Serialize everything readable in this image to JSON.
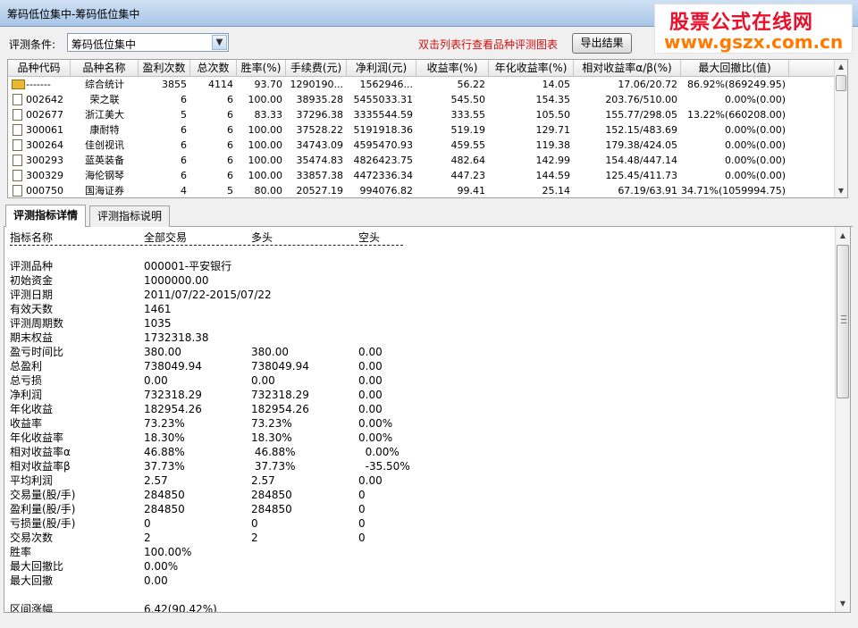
{
  "window": {
    "title": "筹码低位集中-筹码低位集中"
  },
  "watermark": {
    "line1": "股票公式在线网",
    "line2": "www.gszx.com.cn"
  },
  "toolbar": {
    "condition_label": "评测条件:",
    "condition_value": "筹码低位集中",
    "hint": "双击列表行查看品种评测图表",
    "export_label": "导出结果"
  },
  "grid": {
    "columns": [
      "品种代码",
      "品种名称",
      "盈利次数",
      "总次数",
      "胜率(%)",
      "手续费(元)",
      "净利润(元)",
      "收益率(%)",
      "年化收益率(%)",
      "相对收益率α/β(%)",
      "最大回撤比(值)"
    ],
    "rows": [
      {
        "icon": "folder",
        "code": "-------",
        "name": "综合统计",
        "wins": "3855",
        "total": "4114",
        "winrate": "93.70",
        "fee": "1290190...",
        "profit": "1562946...",
        "ret": "56.22",
        "annual": "14.05",
        "rel": "17.06/20.72",
        "dd": "86.92%(869249.95)"
      },
      {
        "icon": "file",
        "code": "002642",
        "name": "荣之联",
        "wins": "6",
        "total": "6",
        "winrate": "100.00",
        "fee": "38935.28",
        "profit": "5455033.31",
        "ret": "545.50",
        "annual": "154.35",
        "rel": "203.76/510.00",
        "dd": "0.00%(0.00)"
      },
      {
        "icon": "file",
        "code": "002677",
        "name": "浙江美大",
        "wins": "5",
        "total": "6",
        "winrate": "83.33",
        "fee": "37296.38",
        "profit": "3335544.59",
        "ret": "333.55",
        "annual": "105.50",
        "rel": "155.77/298.05",
        "dd": "13.22%(660208.00)"
      },
      {
        "icon": "file",
        "code": "300061",
        "name": "康耐特",
        "wins": "6",
        "total": "6",
        "winrate": "100.00",
        "fee": "37528.22",
        "profit": "5191918.36",
        "ret": "519.19",
        "annual": "129.71",
        "rel": "152.15/483.69",
        "dd": "0.00%(0.00)"
      },
      {
        "icon": "file",
        "code": "300264",
        "name": "佳创视讯",
        "wins": "6",
        "total": "6",
        "winrate": "100.00",
        "fee": "34743.09",
        "profit": "4595470.93",
        "ret": "459.55",
        "annual": "119.38",
        "rel": "179.38/424.05",
        "dd": "0.00%(0.00)"
      },
      {
        "icon": "file",
        "code": "300293",
        "name": "蓝英装备",
        "wins": "6",
        "total": "6",
        "winrate": "100.00",
        "fee": "35474.83",
        "profit": "4826423.75",
        "ret": "482.64",
        "annual": "142.99",
        "rel": "154.48/447.14",
        "dd": "0.00%(0.00)"
      },
      {
        "icon": "file",
        "code": "300329",
        "name": "海伦钢琴",
        "wins": "6",
        "total": "6",
        "winrate": "100.00",
        "fee": "33857.38",
        "profit": "4472336.34",
        "ret": "447.23",
        "annual": "144.59",
        "rel": "125.45/411.73",
        "dd": "0.00%(0.00)"
      },
      {
        "icon": "file",
        "code": "000750",
        "name": "国海证券",
        "wins": "4",
        "total": "5",
        "winrate": "80.00",
        "fee": "20527.19",
        "profit": "994076.82",
        "ret": "99.41",
        "annual": "25.14",
        "rel": "67.19/63.91",
        "dd": "34.71%(1059994.75)"
      }
    ]
  },
  "tabs": [
    "评测指标详情",
    "评测指标说明"
  ],
  "details": {
    "header": [
      "指标名称",
      "全部交易",
      "多头",
      "空头"
    ],
    "separator": "------------------------------------------------------------------------",
    "rows": [
      [
        "评测品种",
        "000001-平安银行",
        "",
        ""
      ],
      [
        "初始资金",
        "1000000.00",
        "",
        ""
      ],
      [
        "评测日期",
        "2011/07/22-2015/07/22",
        "",
        ""
      ],
      [
        "有效天数",
        "1461",
        "",
        ""
      ],
      [
        "评测周期数",
        "1035",
        "",
        ""
      ],
      [
        "期末权益",
        "1732318.38",
        "",
        ""
      ],
      [
        "盈亏时间比",
        "380.00",
        "380.00",
        "0.00"
      ],
      [
        "总盈利",
        "738049.94",
        "738049.94",
        "0.00"
      ],
      [
        "总亏损",
        "0.00",
        "0.00",
        "0.00"
      ],
      [
        "净利润",
        "732318.29",
        "732318.29",
        "0.00"
      ],
      [
        "年化收益",
        "182954.26",
        "182954.26",
        "0.00"
      ],
      [
        "收益率",
        "73.23%",
        "73.23%",
        "0.00%"
      ],
      [
        "年化收益率",
        "18.30%",
        "18.30%",
        "0.00%"
      ],
      [
        "相对收益率α",
        "46.88%",
        " 46.88%",
        "  0.00%"
      ],
      [
        "相对收益率β",
        "37.73%",
        " 37.73%",
        "  -35.50%"
      ],
      [
        "平均利润",
        "2.57",
        "2.57",
        "0.00"
      ],
      [
        "交易量(股/手)",
        "284850",
        "284850",
        "0"
      ],
      [
        "盈利量(股/手)",
        "284850",
        "284850",
        "0"
      ],
      [
        "亏损量(股/手)",
        "0",
        "0",
        "0"
      ],
      [
        "交易次数",
        "2",
        "2",
        "0"
      ],
      [
        "胜率",
        "100.00%",
        "",
        ""
      ],
      [
        "最大回撤比",
        "0.00%",
        "",
        ""
      ],
      [
        "最大回撤",
        "0.00",
        "",
        ""
      ],
      [
        "",
        "",
        "",
        ""
      ],
      [
        "区间涨幅",
        "6.42(90.42%)",
        "",
        ""
      ]
    ]
  }
}
